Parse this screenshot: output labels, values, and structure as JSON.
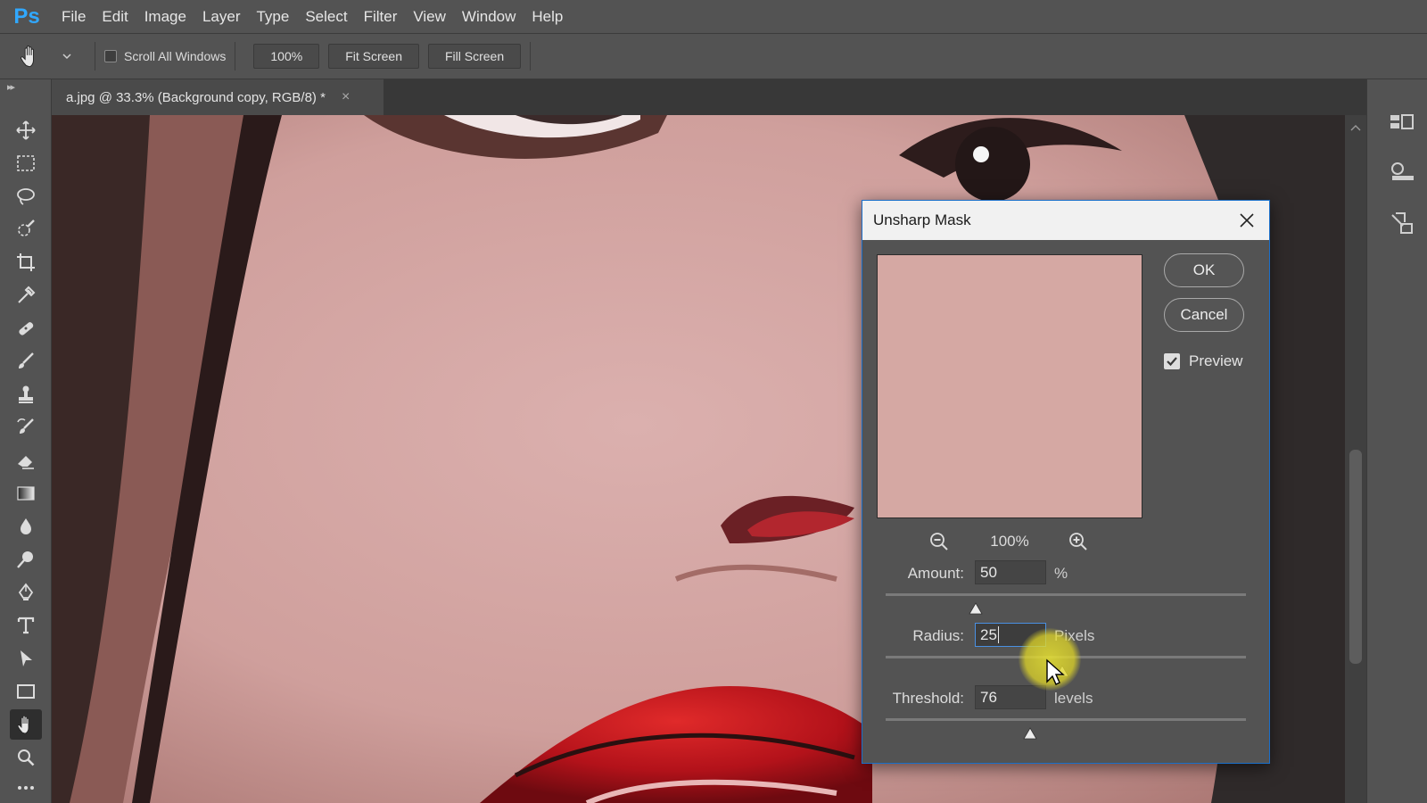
{
  "app": {
    "logo": "Ps"
  },
  "menu": [
    "File",
    "Edit",
    "Image",
    "Layer",
    "Type",
    "Select",
    "Filter",
    "View",
    "Window",
    "Help"
  ],
  "options": {
    "tool_icon": "hand-icon",
    "scroll_all_windows": {
      "label": "Scroll All Windows",
      "checked": false
    },
    "zoom_button": "100%",
    "fit_screen": "Fit Screen",
    "fill_screen": "Fill Screen"
  },
  "tab": {
    "title": "a.jpg @ 33.3% (Background copy, RGB/8) *",
    "close": "×"
  },
  "tools": [
    "move-icon",
    "marquee-icon",
    "lasso-icon",
    "quick-select-icon",
    "crop-icon",
    "eyedropper-icon",
    "healing-brush-icon",
    "brush-icon",
    "stamp-icon",
    "history-brush-icon",
    "eraser-icon",
    "gradient-icon",
    "blur-icon",
    "dodge-icon",
    "pen-icon",
    "type-icon",
    "path-select-icon",
    "rectangle-icon",
    "hand-icon",
    "zoom-icon",
    "more-icon"
  ],
  "active_tool": "hand-icon",
  "dialog": {
    "title": "Unsharp Mask",
    "ok": "OK",
    "cancel": "Cancel",
    "preview": {
      "label": "Preview",
      "checked": true
    },
    "zoom_level": "100%",
    "preview_color": "#d5a8a3",
    "amount": {
      "label": "Amount:",
      "value": "50",
      "unit": "%",
      "slider_fraction": 0.25
    },
    "radius": {
      "label": "Radius:",
      "value": "25",
      "unit": "Pixels",
      "slider_fraction": 0.49
    },
    "threshold": {
      "label": "Threshold:",
      "value": "76",
      "unit": "levels",
      "slider_fraction": 0.4
    }
  },
  "colors": {
    "accent": "#31a8ff",
    "dialog_border": "#1a6fc9",
    "focus": "#4a90e2"
  }
}
